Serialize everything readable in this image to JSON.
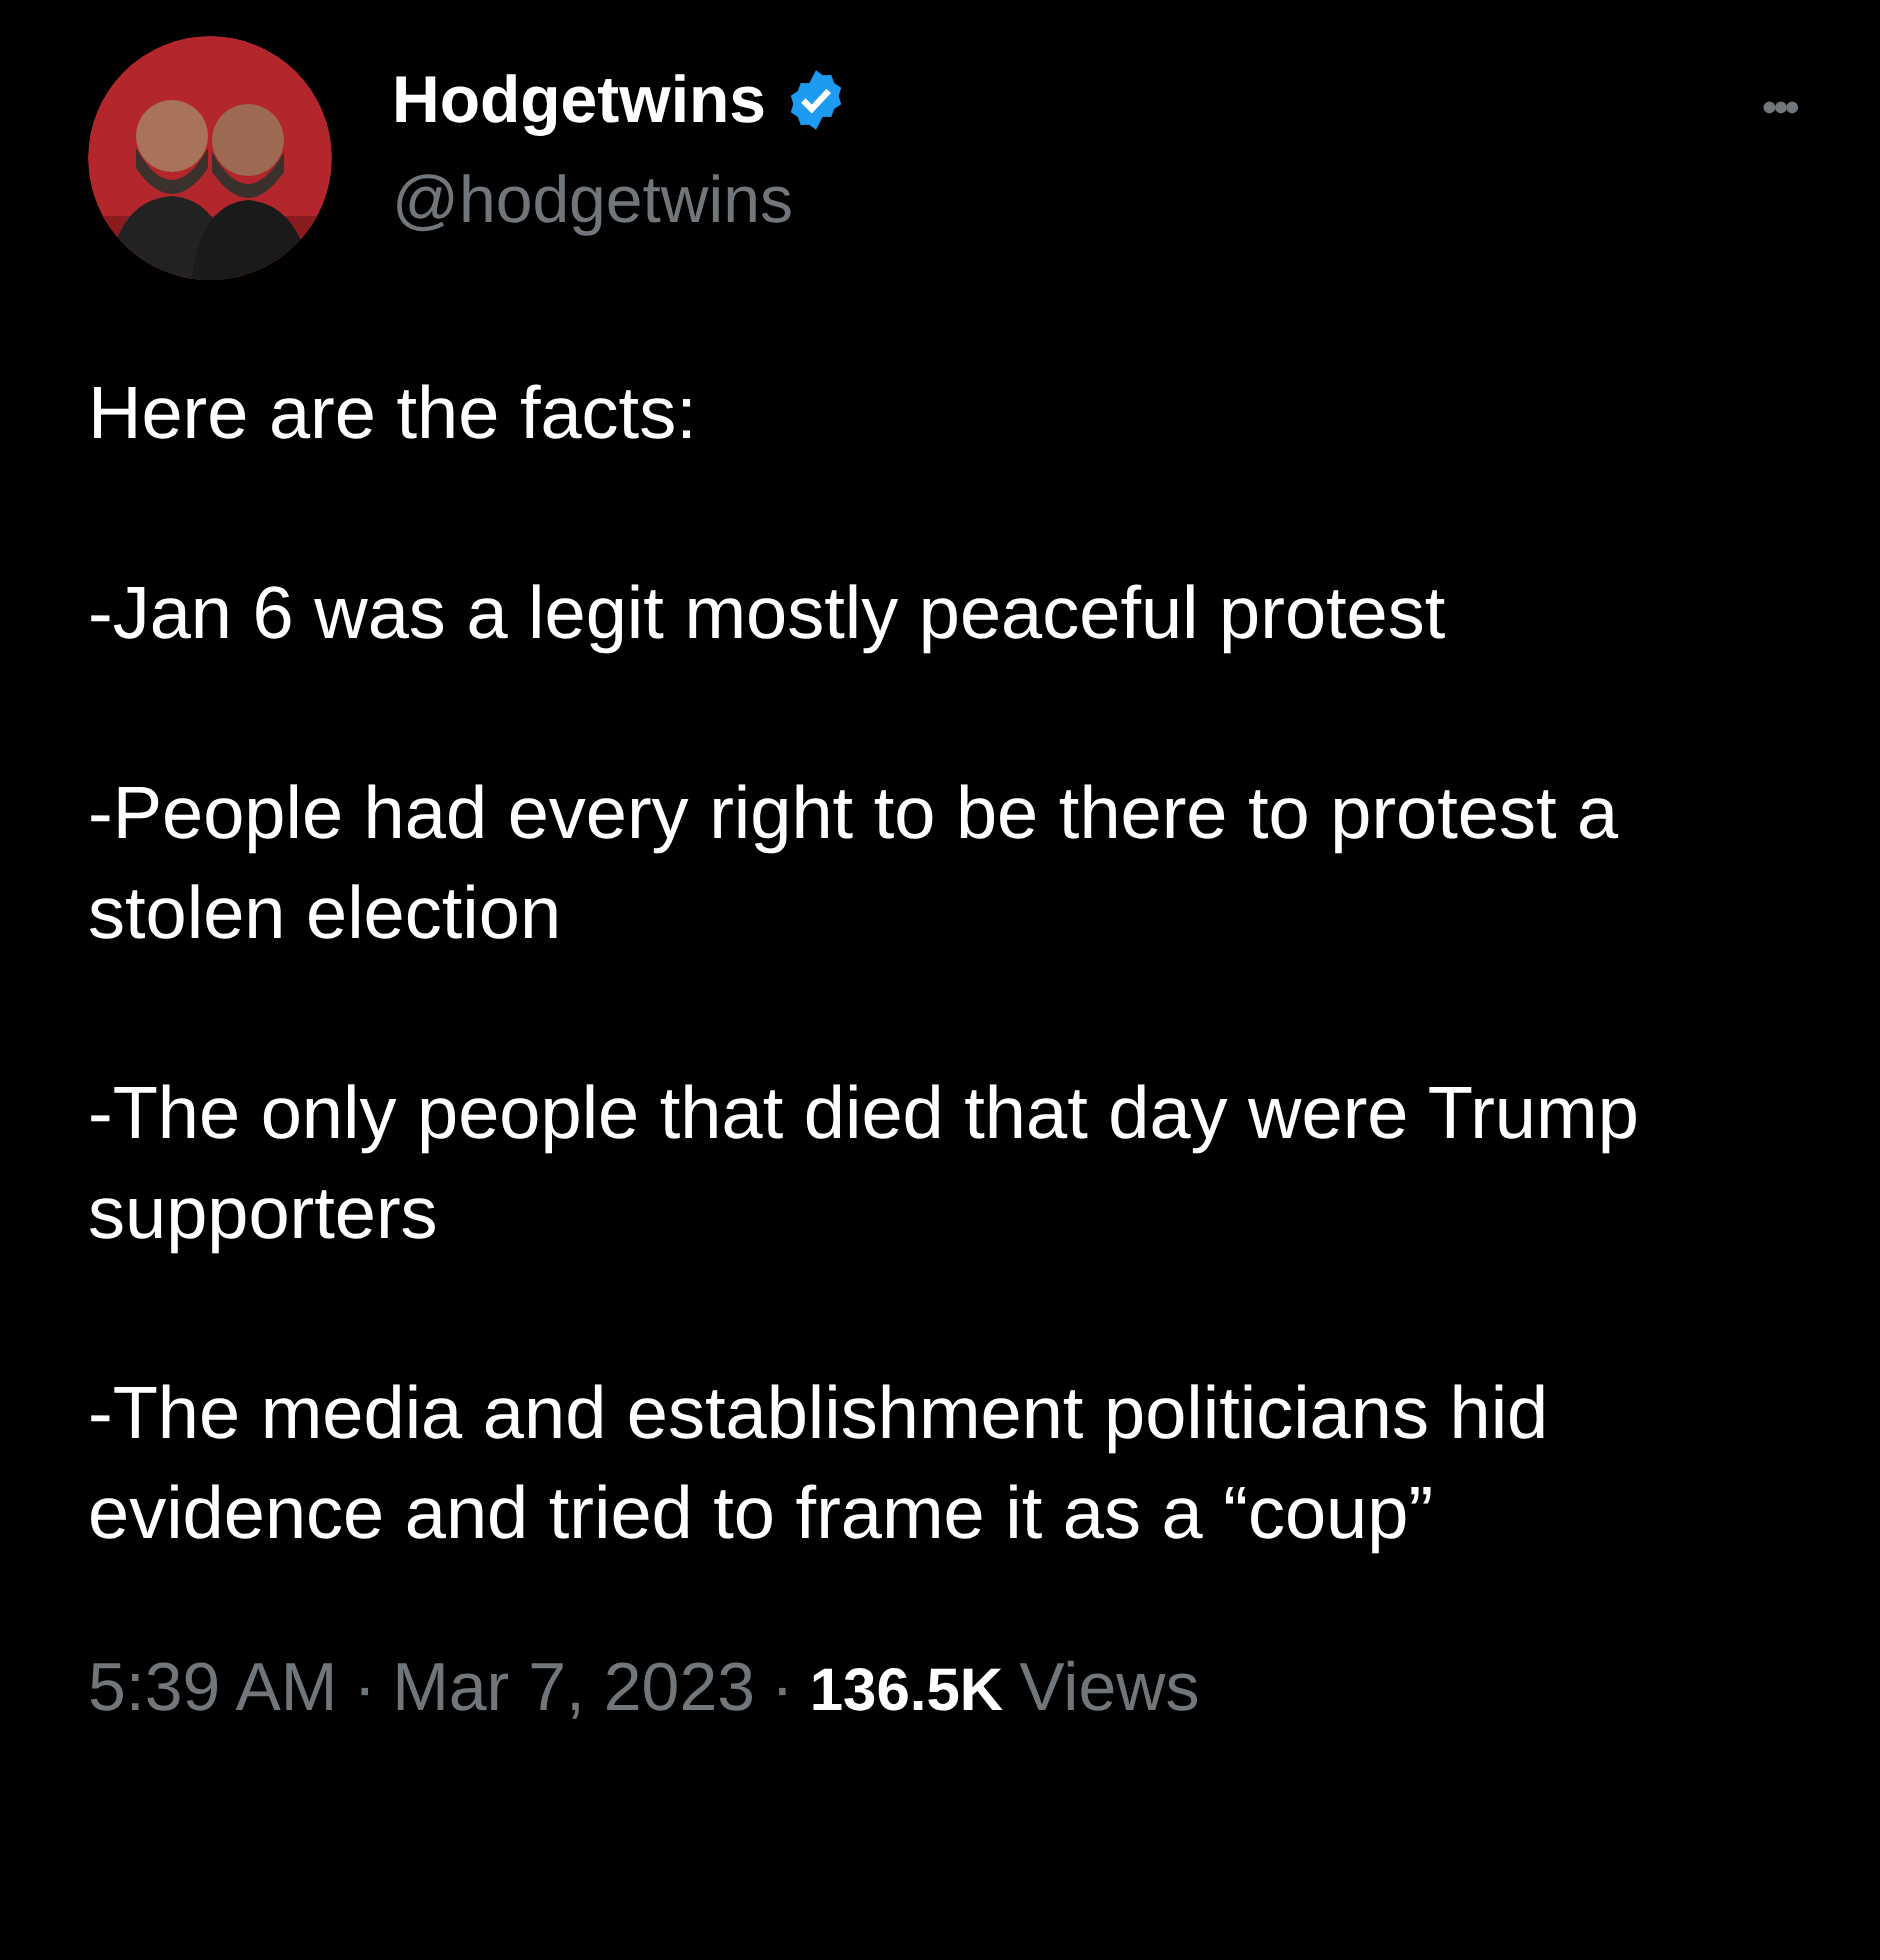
{
  "author": {
    "name": "Hodgetwins",
    "verified": true,
    "handle": "@hodgetwins"
  },
  "more": "•••",
  "paragraphs": [
    "Here are the facts:",
    "-Jan 6 was a legit mostly peaceful protest",
    "-People had every right to be there to protest a stolen election",
    "-The only people that died that day were Trump supporters",
    "-The media and establishment politicians hid evidence and tried to frame it as a “coup”"
  ],
  "meta": {
    "time": "5:39 AM",
    "separators": [
      "·",
      "·"
    ],
    "date": "Mar 7, 2023",
    "views": "136.5K",
    "views_label": "Views"
  }
}
